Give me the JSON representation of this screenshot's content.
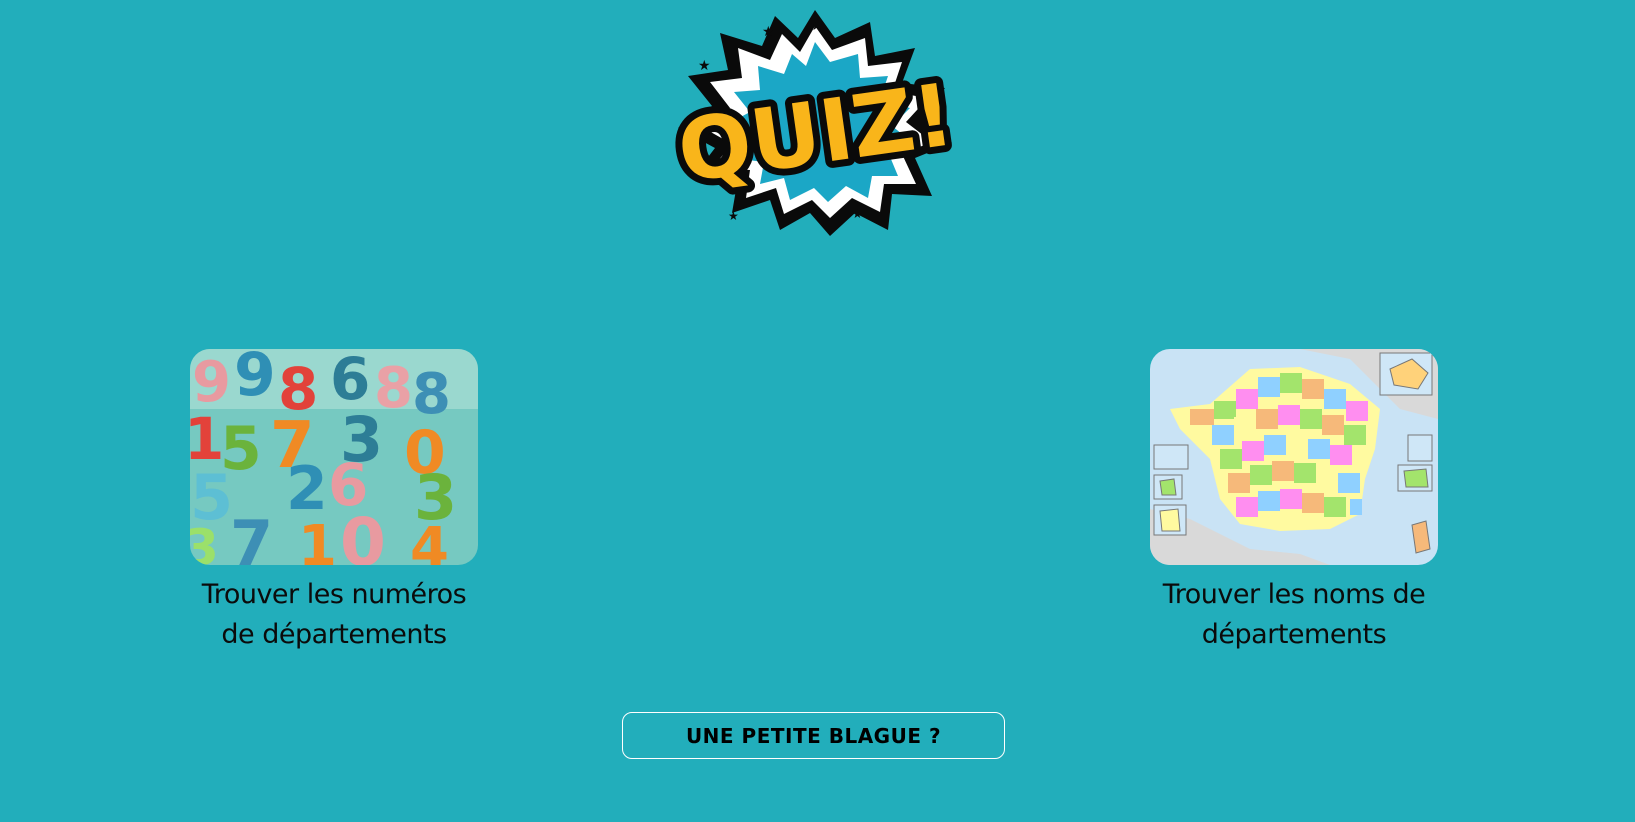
{
  "header": {
    "logo_text": "QUIZ!",
    "colors": {
      "background": "#22aebb",
      "logo_fill": "#f9b51a",
      "burst_inner": "#1ba7c6"
    }
  },
  "cards": [
    {
      "label": "Trouver les numéros de départements",
      "image": "colorful-numbers-photo"
    },
    {
      "label": "Trouver les noms de départements",
      "image": "france-departments-map"
    }
  ],
  "joke_button": {
    "label": "UNE PETITE BLAGUE ?"
  }
}
